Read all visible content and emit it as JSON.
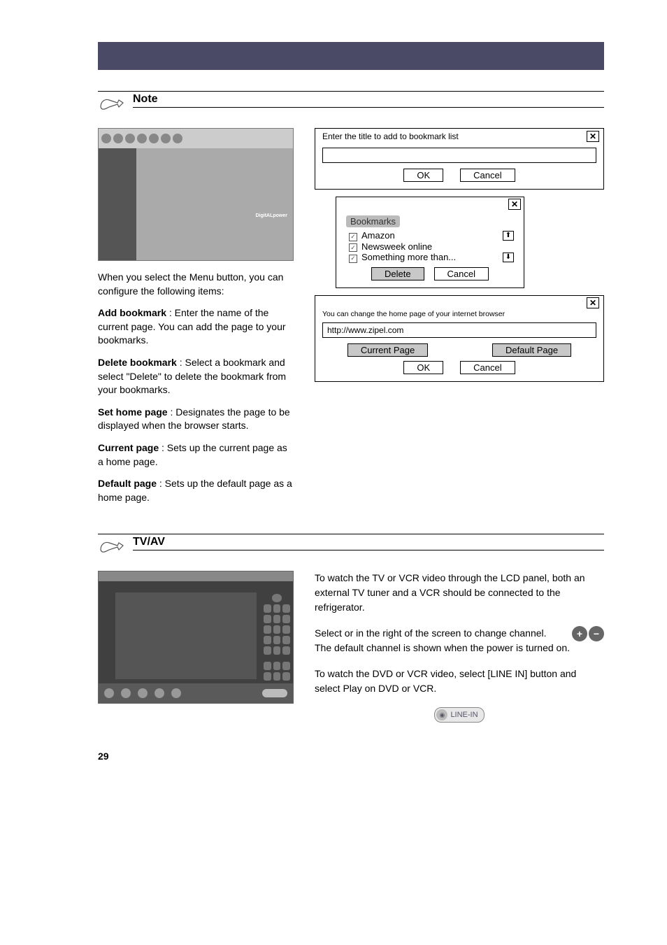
{
  "page_number": "29",
  "section1": {
    "note_title": "Note",
    "intro": "When you select the Menu button, you can configure the following items:",
    "dialog_addbookmark": {
      "label": "Enter the title to add to bookmark list",
      "ok": "OK",
      "cancel": "Cancel"
    },
    "items": {
      "add_label": "Add bookmark",
      "add_desc": ": Enter the name of the current page. You can add the page to your bookmarks.",
      "delete_label": "Delete bookmark",
      "delete_desc": ": Select a bookmark and select \"Delete\" to delete the bookmark from your bookmarks.",
      "set_label": "Set home page",
      "set_desc": ": Designates the page to be displayed when the browser starts.",
      "current_label": "Current page",
      "current_desc": ": Sets up the current page as a home page.",
      "default_label": "Default page",
      "default_desc": ": Sets up the default page as a home page."
    },
    "bookmarks_panel": {
      "title": "Bookmarks",
      "items": [
        "Amazon",
        "Newsweek online",
        "Something more than..."
      ],
      "delete": "Delete",
      "cancel": "Cancel"
    },
    "homepage_dialog": {
      "msg": "You can change the home page of your internet browser",
      "url": "http://www.zipel.com",
      "current": "Current Page",
      "default": "Default Page",
      "ok": "OK",
      "cancel": "Cancel"
    }
  },
  "section2": {
    "note_title": "TV/AV",
    "p1": "To watch the TV or VCR video through the LCD panel, both an external TV tuner and a VCR should be connected to the refrigerator.",
    "p2_a": "Select         or        in the right of the screen to change channel.",
    "p2_b": "The default channel is shown when the power is turned on.",
    "p3_a": "To watch the DVD or VCR video, select [LINE IN] button ",
    "p3_b": " and select Play on DVD or VCR.",
    "linein_label": "LINE-IN"
  }
}
